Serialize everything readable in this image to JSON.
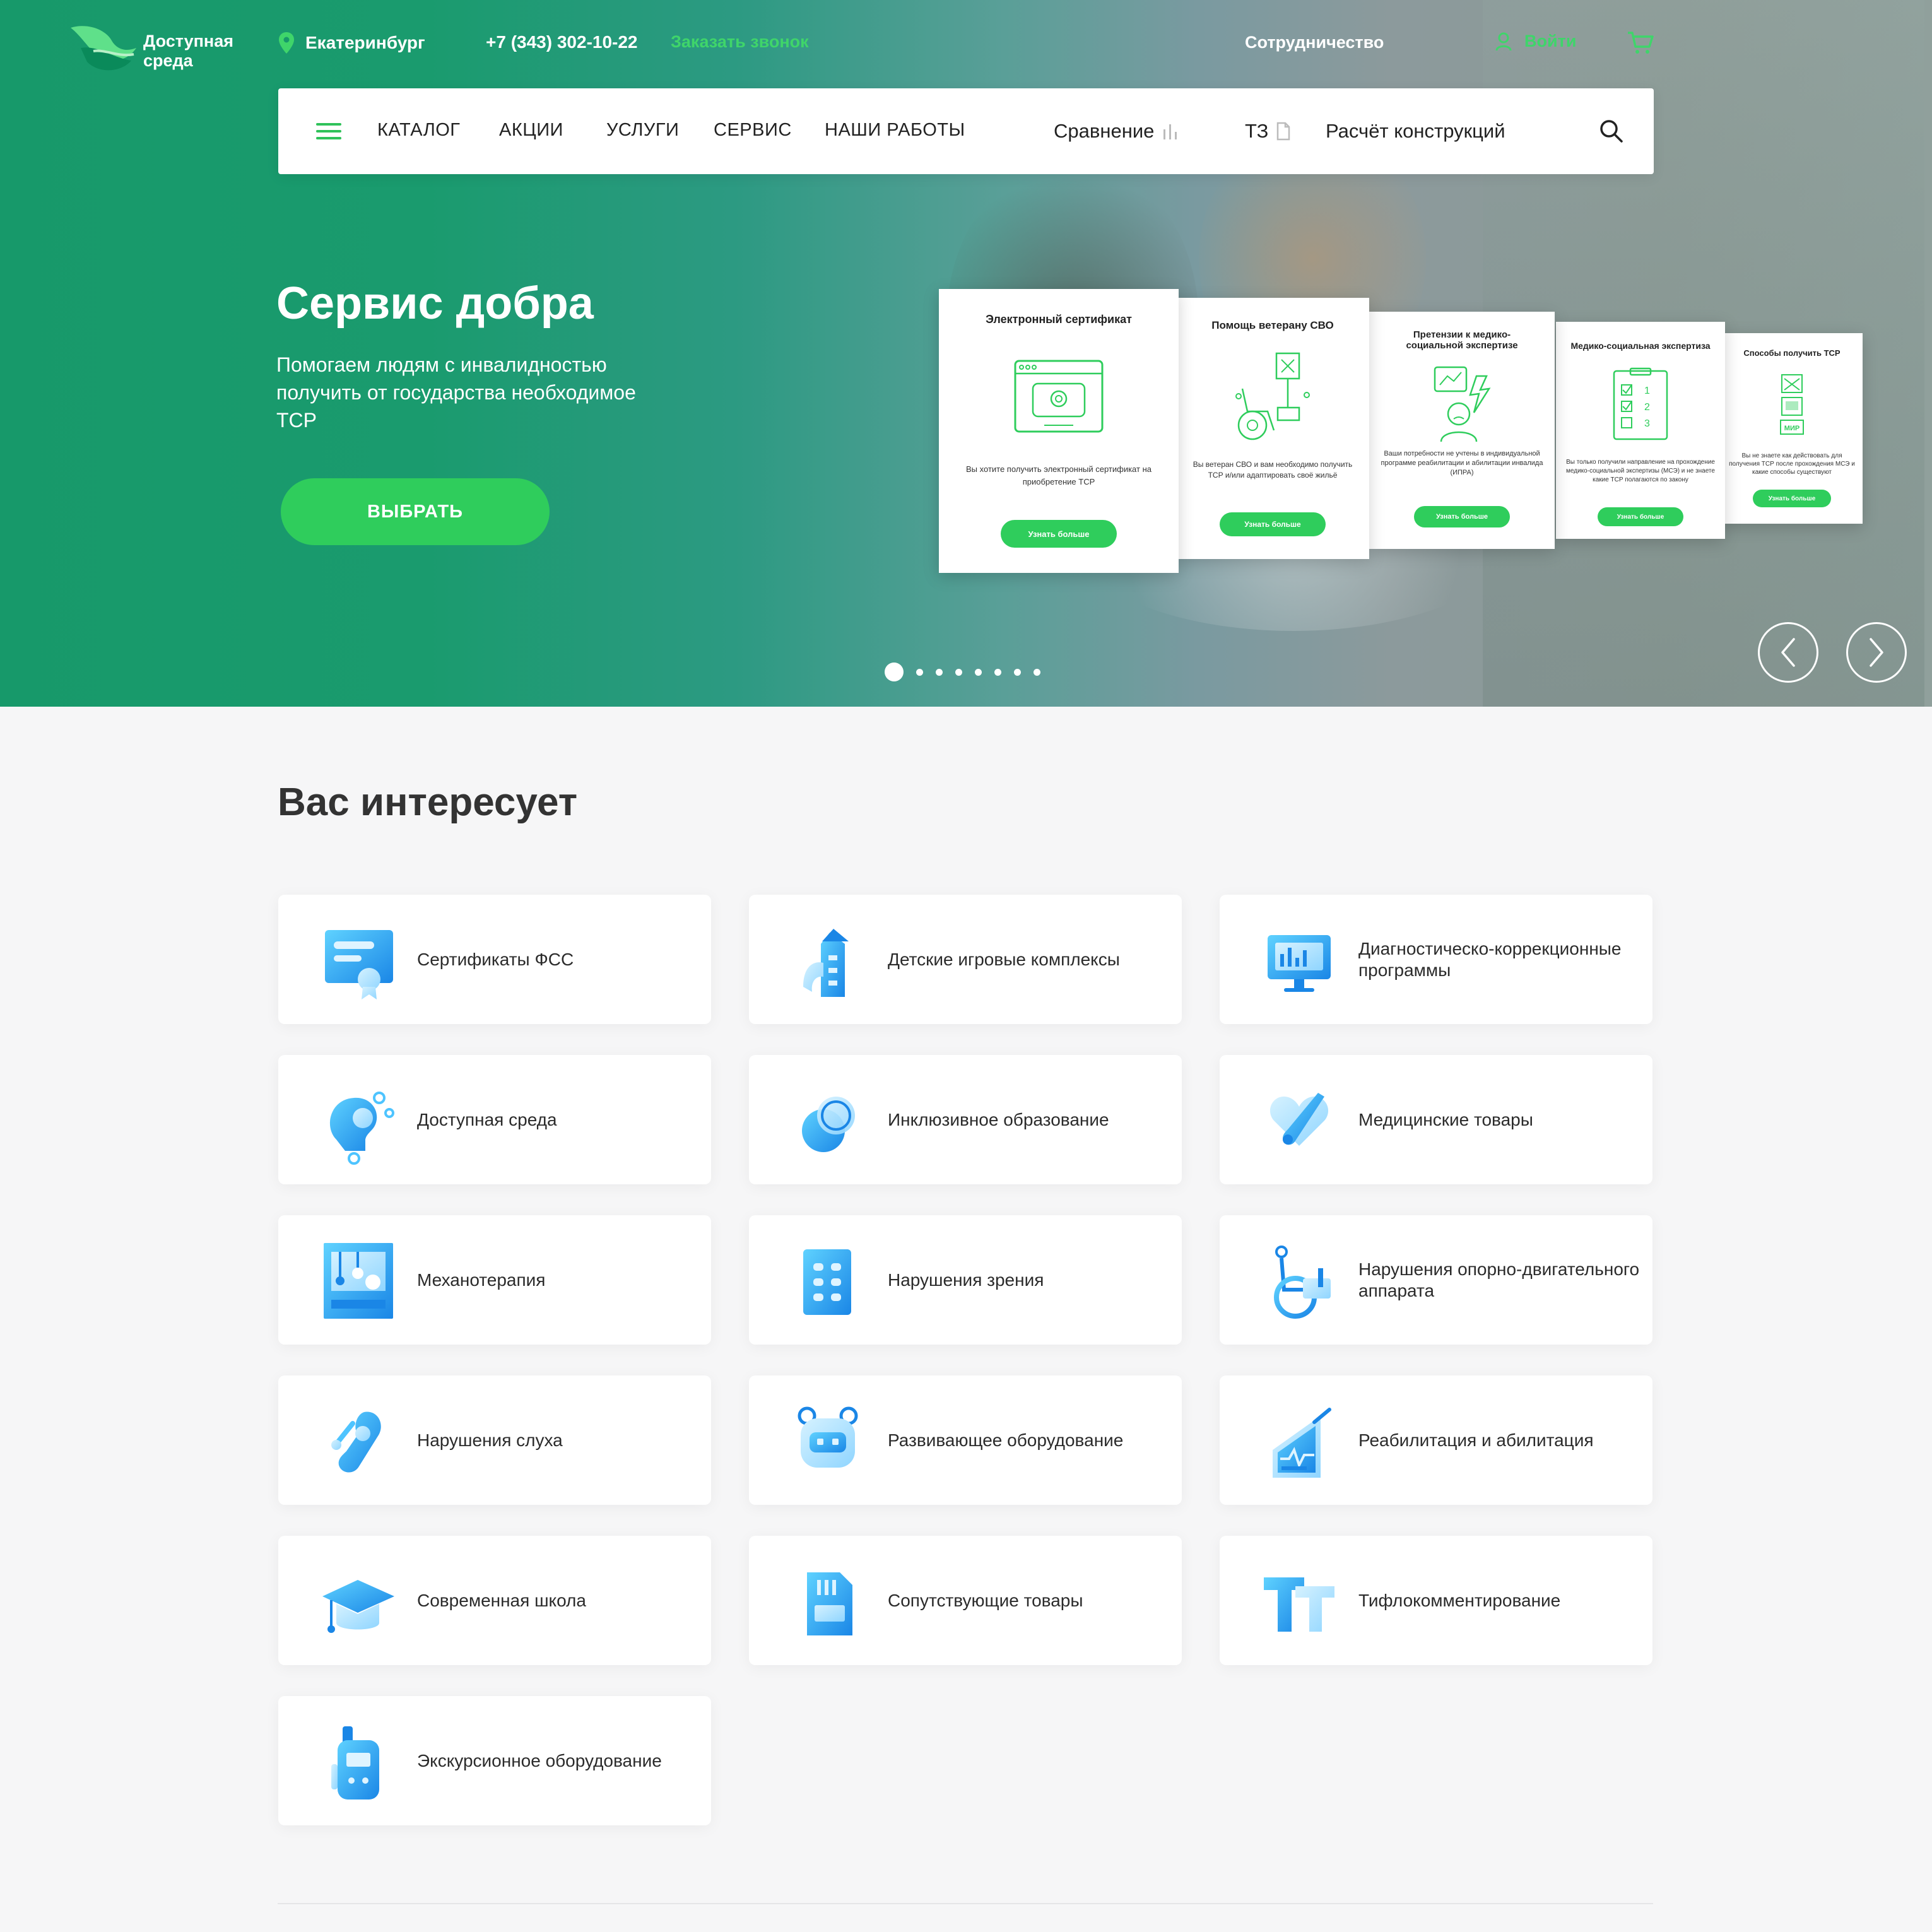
{
  "header": {
    "logo_line1": "Доступная",
    "logo_line2": "среда",
    "city": "Екатеринбург",
    "phone": "+7 (343) 302-10-22",
    "callback": "Заказать звонок",
    "partnership": "Сотрудничество",
    "login": "Войти"
  },
  "nav": {
    "items": [
      "КАТАЛОГ",
      "АКЦИИ",
      "УСЛУГИ",
      "СЕРВИС",
      "НАШИ РАБОТЫ"
    ],
    "compare": "Сравнение",
    "tz": "ТЗ",
    "calc": "Расчёт конструкций"
  },
  "hero": {
    "title": "Сервис добра",
    "subtitle": "Помогаем людям с инвалидностью получить от государства необходимое ТСР",
    "cta": "ВЫБРАТЬ",
    "slides_total": 8,
    "active_slide": 1,
    "cards": [
      {
        "title": "Электронный сертификат",
        "desc": "Вы хотите получить электронный сертификат на приобретение ТСР",
        "button": "Узнать больше"
      },
      {
        "title": "Помощь ветерану СВО",
        "desc": "Вы ветеран СВО и вам необходимо получить ТСР и/или адаптировать своё жильё",
        "button": "Узнать больше"
      },
      {
        "title": "Претензии к медико-социальной экспертизе",
        "desc": "Ваши потребности не учтены в индивидуальной программе реабилитации и абилитации инвалида (ИПРА)",
        "button": "Узнать больше"
      },
      {
        "title": "Медико-социальная экспертиза",
        "desc": "Вы только получили направление на прохождение медико-социальной экспертизы (МСЭ) и не знаете какие ТСР полагаются по закону",
        "button": "Узнать больше"
      },
      {
        "title": "Способы получить ТСР",
        "desc": "Вы не знаете как действовать для получения ТСР после прохождения МСЭ и какие способы существуют",
        "button": "Узнать больше",
        "badge": "МИР"
      }
    ]
  },
  "interests": {
    "title": "Вас интересует",
    "items": [
      {
        "label": "Сертификаты ФСС",
        "icon": "certificate-icon"
      },
      {
        "label": "Детские игровые комплексы",
        "icon": "playground-icon"
      },
      {
        "label": "Диагностическо-коррекционные программы",
        "icon": "monitor-chart-icon"
      },
      {
        "label": "Доступная среда",
        "icon": "head-bubbles-icon"
      },
      {
        "label": "Инклюзивное образование",
        "icon": "circles-icon"
      },
      {
        "label": "Медицинские товары",
        "icon": "heart-thermometer-icon"
      },
      {
        "label": "Механотерапия",
        "icon": "mechanotherapy-icon"
      },
      {
        "label": "Нарушения зрения",
        "icon": "braille-icon"
      },
      {
        "label": "Нарушения опорно-двигательного аппарата",
        "icon": "wheelchair-icon"
      },
      {
        "label": "Нарушения слуха",
        "icon": "hearing-aid-icon"
      },
      {
        "label": "Развивающее оборудование",
        "icon": "toy-robot-icon"
      },
      {
        "label": "Реабилитация и абилитация",
        "icon": "rehab-monitor-icon"
      },
      {
        "label": "Современная школа",
        "icon": "graduation-cap-icon"
      },
      {
        "label": "Сопутствующие товары",
        "icon": "sd-card-icon"
      },
      {
        "label": "Тифлокомментирование",
        "icon": "text-tt-icon"
      },
      {
        "label": "Экскурсионное оборудование",
        "icon": "radio-guide-icon"
      }
    ]
  },
  "colors": {
    "accent_green": "#2fcd5c",
    "icon_blue": "#1e9be8",
    "hero_green": "#17996a"
  }
}
